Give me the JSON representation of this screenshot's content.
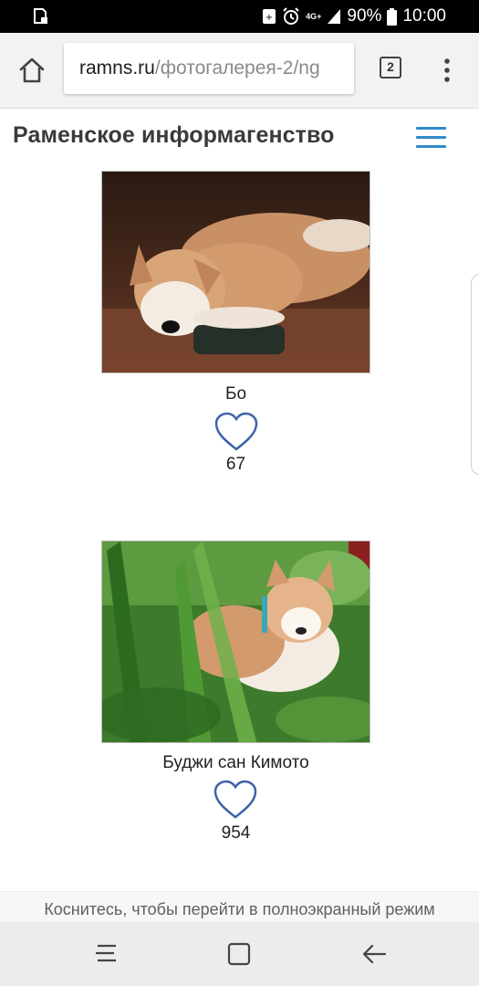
{
  "status_bar": {
    "battery": "90%",
    "time": "10:00",
    "network": "4G+",
    "icons": [
      "screenshot-icon",
      "data-saver-icon",
      "alarm-icon",
      "signal-icon",
      "battery-icon"
    ]
  },
  "browser": {
    "url_domain": "ramns.ru",
    "url_path": "/фотогалерея-2/ng",
    "tab_count": "2"
  },
  "site": {
    "title": "Раменское информагенство"
  },
  "gallery": {
    "items": [
      {
        "name": "Бо",
        "likes": "67"
      },
      {
        "name": "Буджи сан Кимото",
        "likes": "954"
      }
    ]
  },
  "hint": {
    "fullscreen": "Коснитесь, чтобы перейти в полноэкранный режим"
  },
  "colors": {
    "accent": "#2f8acb",
    "heart_stroke": "#3d63a8"
  }
}
